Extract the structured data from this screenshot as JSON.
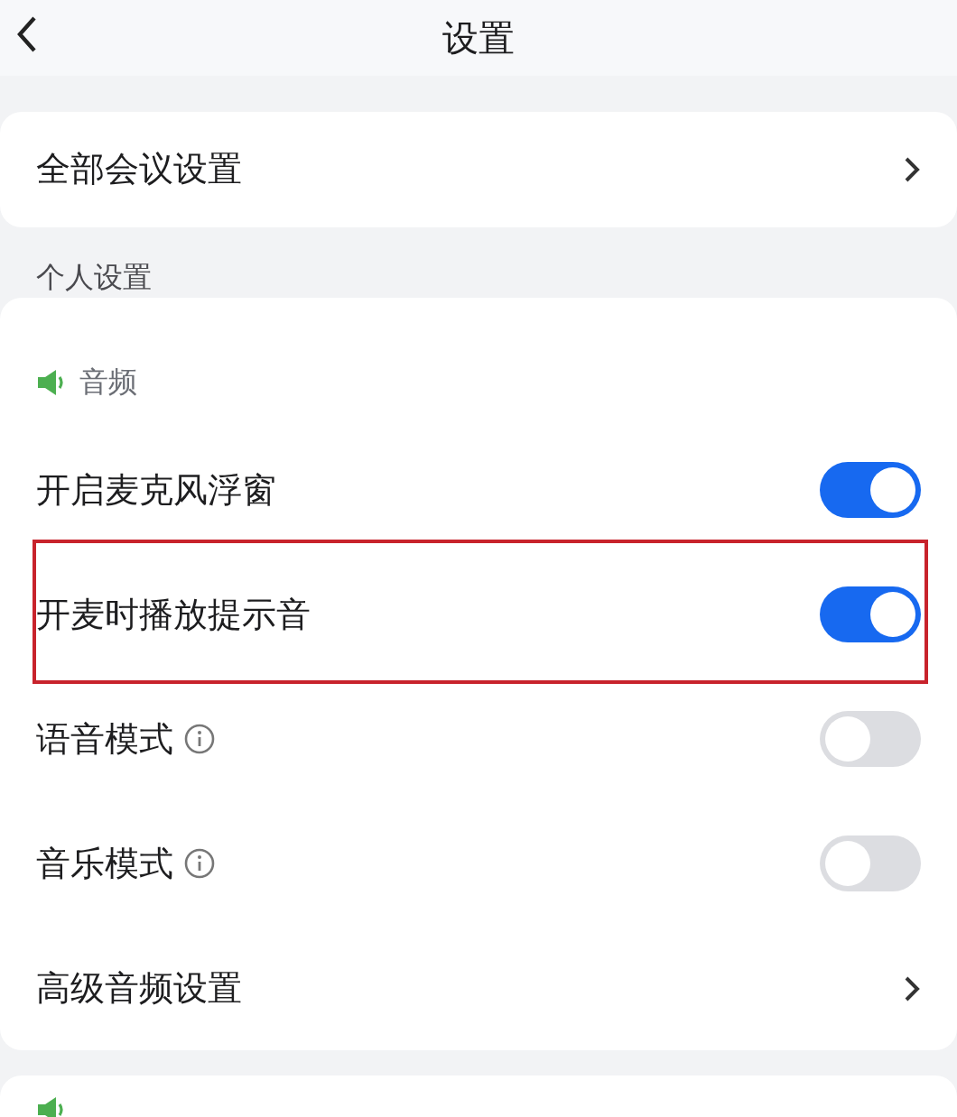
{
  "header": {
    "title": "设置"
  },
  "top_card": {
    "label": "全部会议设置"
  },
  "section_label": "个人设置",
  "audio": {
    "heading": "音频",
    "rows": [
      {
        "kind": "toggle",
        "label": "开启麦克风浮窗",
        "info": false,
        "on": true,
        "highlighted": false
      },
      {
        "kind": "toggle",
        "label": "开麦时播放提示音",
        "info": false,
        "on": true,
        "highlighted": true
      },
      {
        "kind": "toggle",
        "label": "语音模式",
        "info": true,
        "on": false,
        "highlighted": false
      },
      {
        "kind": "toggle",
        "label": "音乐模式",
        "info": true,
        "on": false,
        "highlighted": false
      },
      {
        "kind": "link",
        "label": "高级音频设置",
        "info": false,
        "highlighted": false
      }
    ]
  }
}
